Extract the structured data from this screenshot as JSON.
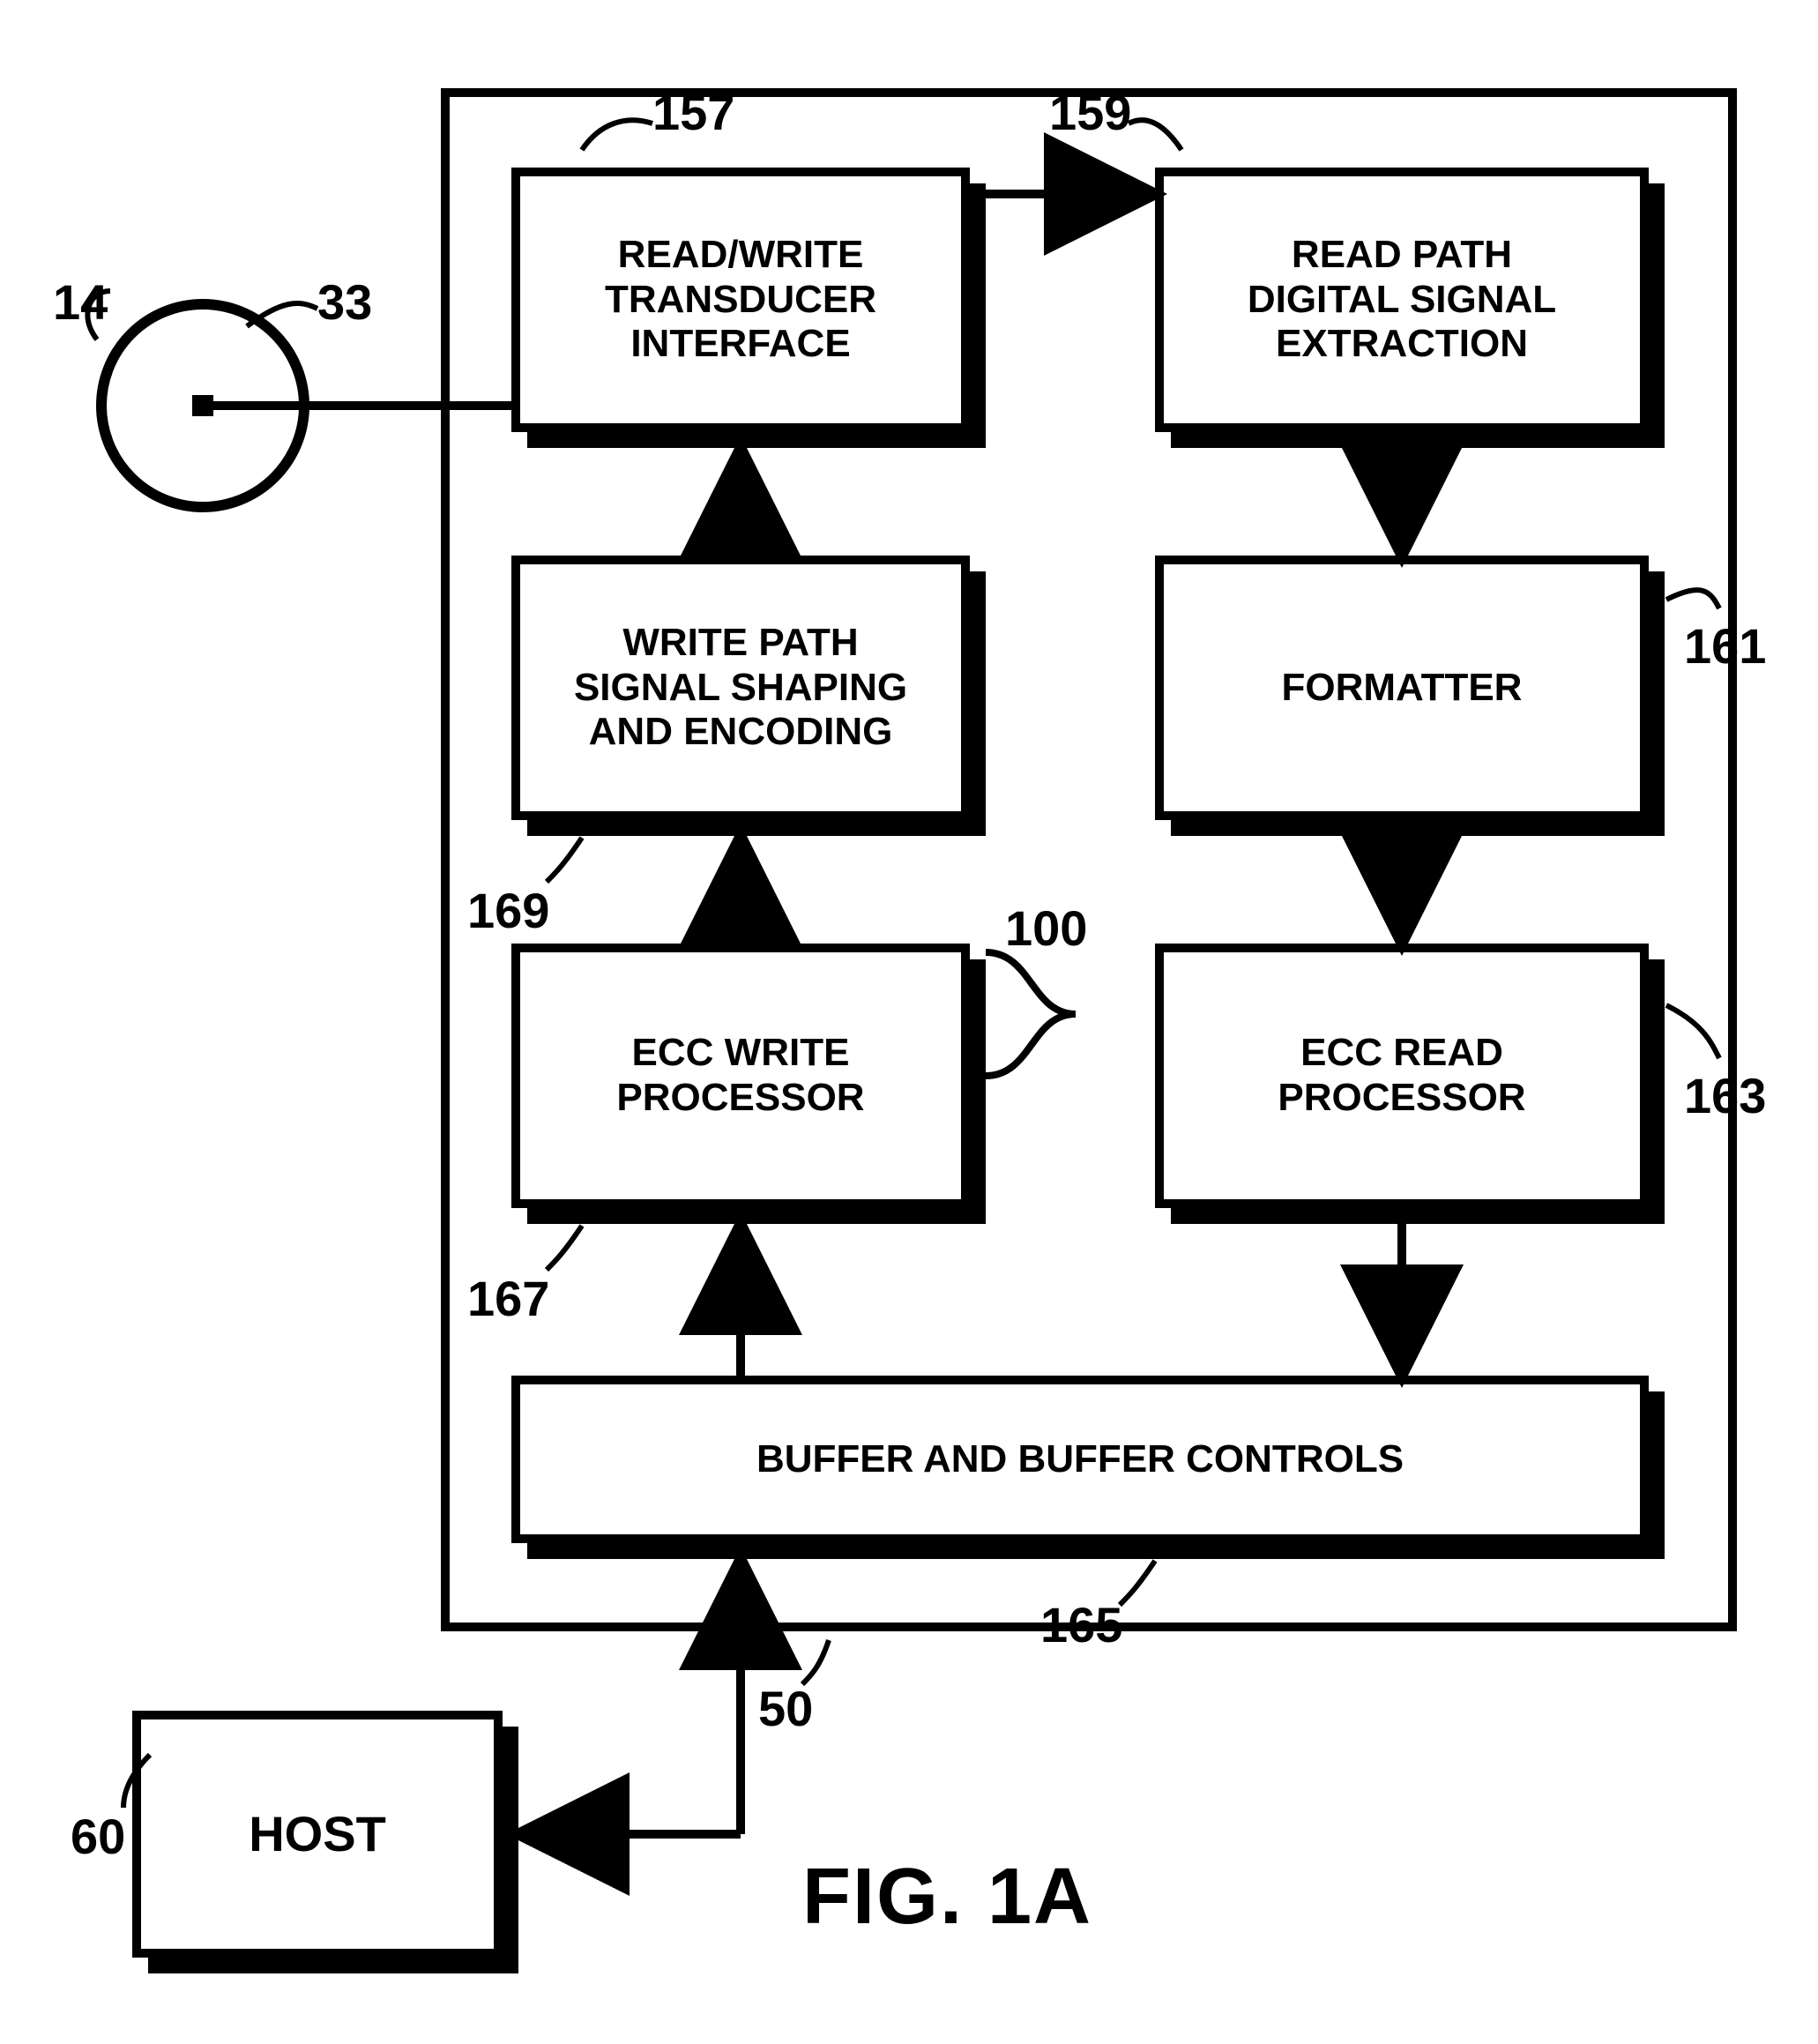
{
  "blocks": {
    "rw_transducer": "READ/WRITE\nTRANSDUCER\nINTERFACE",
    "read_path": "READ PATH\nDIGITAL SIGNAL\nEXTRACTION",
    "write_path": "WRITE PATH\nSIGNAL SHAPING\nAND ENCODING",
    "formatter": "FORMATTER",
    "ecc_write": "ECC WRITE\nPROCESSOR",
    "ecc_read": "ECC READ\nPROCESSOR",
    "buffer": "BUFFER AND BUFFER CONTROLS",
    "host": "HOST"
  },
  "refs": {
    "disk_outer": "14",
    "disk_inner": "33",
    "frame": "50",
    "host": "60",
    "ref_100": "100",
    "rw_transducer": "157",
    "read_path": "159",
    "formatter": "161",
    "ecc_read": "163",
    "buffer": "165",
    "ecc_write": "167",
    "write_path": "169"
  },
  "caption": "FIG. 1A"
}
